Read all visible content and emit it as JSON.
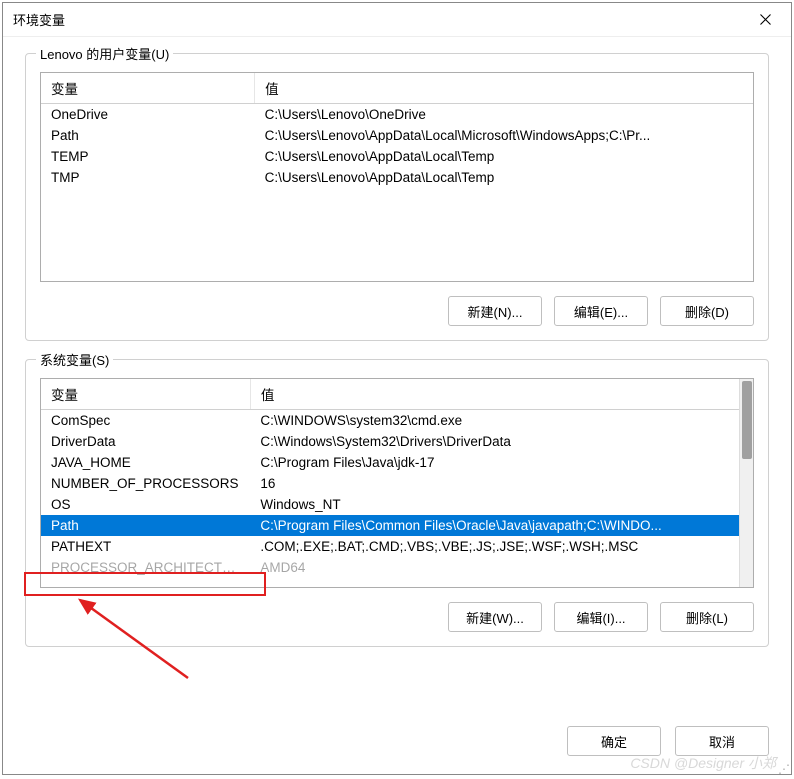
{
  "window": {
    "title": "环境变量"
  },
  "user_group": {
    "label": "Lenovo 的用户变量(U)",
    "headers": {
      "variable": "变量",
      "value": "值"
    },
    "rows": [
      {
        "variable": "OneDrive",
        "value": "C:\\Users\\Lenovo\\OneDrive"
      },
      {
        "variable": "Path",
        "value": "C:\\Users\\Lenovo\\AppData\\Local\\Microsoft\\WindowsApps;C:\\Pr..."
      },
      {
        "variable": "TEMP",
        "value": "C:\\Users\\Lenovo\\AppData\\Local\\Temp"
      },
      {
        "variable": "TMP",
        "value": "C:\\Users\\Lenovo\\AppData\\Local\\Temp"
      }
    ],
    "buttons": {
      "new": "新建(N)...",
      "edit": "编辑(E)...",
      "delete": "删除(D)"
    }
  },
  "system_group": {
    "label": "系统变量(S)",
    "headers": {
      "variable": "变量",
      "value": "值"
    },
    "rows": [
      {
        "variable": "ComSpec",
        "value": "C:\\WINDOWS\\system32\\cmd.exe"
      },
      {
        "variable": "DriverData",
        "value": "C:\\Windows\\System32\\Drivers\\DriverData"
      },
      {
        "variable": "JAVA_HOME",
        "value": "C:\\Program Files\\Java\\jdk-17"
      },
      {
        "variable": "NUMBER_OF_PROCESSORS",
        "value": "16"
      },
      {
        "variable": "OS",
        "value": "Windows_NT"
      },
      {
        "variable": "Path",
        "value": "C:\\Program Files\\Common Files\\Oracle\\Java\\javapath;C:\\WINDO...",
        "selected": true
      },
      {
        "variable": "PATHEXT",
        "value": ".COM;.EXE;.BAT;.CMD;.VBS;.VBE;.JS;.JSE;.WSF;.WSH;.MSC"
      },
      {
        "variable": "PROCESSOR_ARCHITECTURE",
        "value": "AMD64",
        "clipped": true
      }
    ],
    "buttons": {
      "new": "新建(W)...",
      "edit": "编辑(I)...",
      "delete": "删除(L)"
    }
  },
  "dialog_buttons": {
    "ok": "确定",
    "cancel": "取消"
  },
  "watermark": "CSDN @Designer 小郑"
}
